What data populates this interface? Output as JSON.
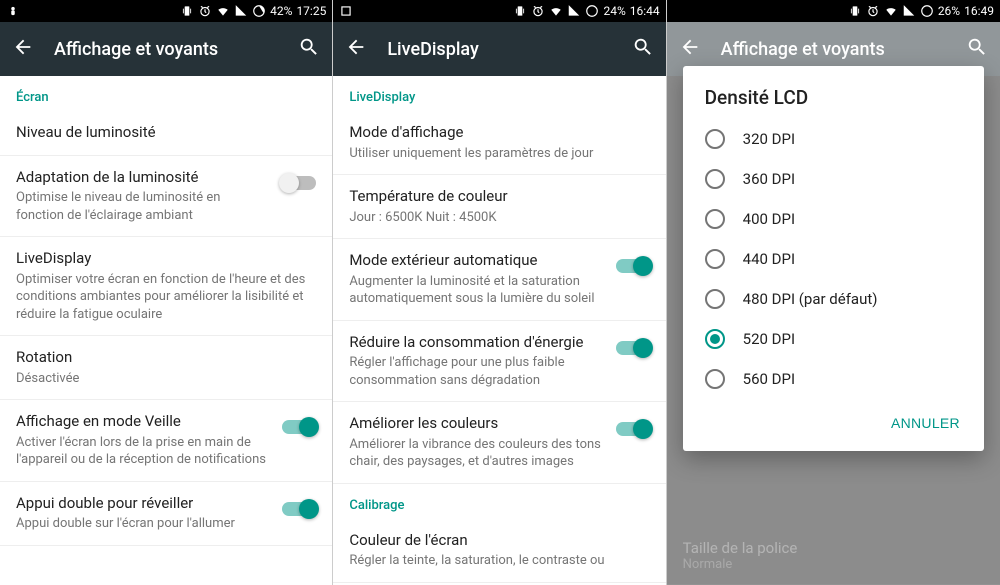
{
  "panel1": {
    "status": {
      "battery": "42%",
      "time": "17:25"
    },
    "toolbar_title": "Affichage et voyants",
    "sections": {
      "ecran": {
        "header": "Écran",
        "items": [
          {
            "title": "Niveau de luminosité",
            "sub": "",
            "toggle": null
          },
          {
            "title": "Adaptation de la luminosité",
            "sub": "Optimise le niveau de luminosité en fonction de l'éclairage ambiant",
            "toggle": false
          },
          {
            "title": "LiveDisplay",
            "sub": "Optimiser votre écran en fonction de l'heure et des conditions ambiantes pour améliorer la lisibilité et réduire la fatigue oculaire",
            "toggle": null
          },
          {
            "title": "Rotation",
            "sub": "Désactivée",
            "toggle": null
          },
          {
            "title": "Affichage en mode Veille",
            "sub": "Activer l'écran lors de la prise en main de l'appareil ou de la réception de notifications",
            "toggle": true
          },
          {
            "title": "Appui double pour réveiller",
            "sub": "Appui double sur l'écran pour l'allumer",
            "toggle": true
          }
        ]
      }
    }
  },
  "panel2": {
    "status": {
      "battery": "24%",
      "time": "16:44"
    },
    "toolbar_title": "LiveDisplay",
    "sections": {
      "live": {
        "header": "LiveDisplay",
        "items": [
          {
            "title": "Mode d'affichage",
            "sub": "Utiliser uniquement les paramètres de jour",
            "toggle": null
          },
          {
            "title": "Température de couleur",
            "sub": "Jour : 6500K Nuit : 4500K",
            "toggle": null
          },
          {
            "title": "Mode extérieur automatique",
            "sub": "Augmenter la luminosité et la saturation automatiquement sous la lumière du soleil",
            "toggle": true
          },
          {
            "title": "Réduire la consommation d'énergie",
            "sub": "Régler l'affichage pour une plus faible consommation sans dégradation",
            "toggle": true
          },
          {
            "title": "Améliorer les couleurs",
            "sub": "Améliorer la vibrance des couleurs des tons chair, des paysages, et d'autres images",
            "toggle": true
          }
        ]
      },
      "calibrage": {
        "header": "Calibrage",
        "items": [
          {
            "title": "Couleur de l'écran",
            "sub": "Régler la teinte, la saturation, le contraste ou",
            "toggle": null
          }
        ]
      }
    }
  },
  "panel3": {
    "status": {
      "battery": "26%",
      "time": "16:49"
    },
    "toolbar_title": "Affichage et voyants",
    "bg_item": {
      "title": "Taille de la police",
      "sub": "Normale"
    },
    "dialog": {
      "title": "Densité LCD",
      "options": [
        {
          "label": "320 DPI",
          "checked": false
        },
        {
          "label": "360 DPI",
          "checked": false
        },
        {
          "label": "400 DPI",
          "checked": false
        },
        {
          "label": "440 DPI",
          "checked": false
        },
        {
          "label": "480 DPI (par défaut)",
          "checked": false
        },
        {
          "label": "520 DPI",
          "checked": true
        },
        {
          "label": "560 DPI",
          "checked": false
        }
      ],
      "cancel": "ANNULER"
    }
  }
}
